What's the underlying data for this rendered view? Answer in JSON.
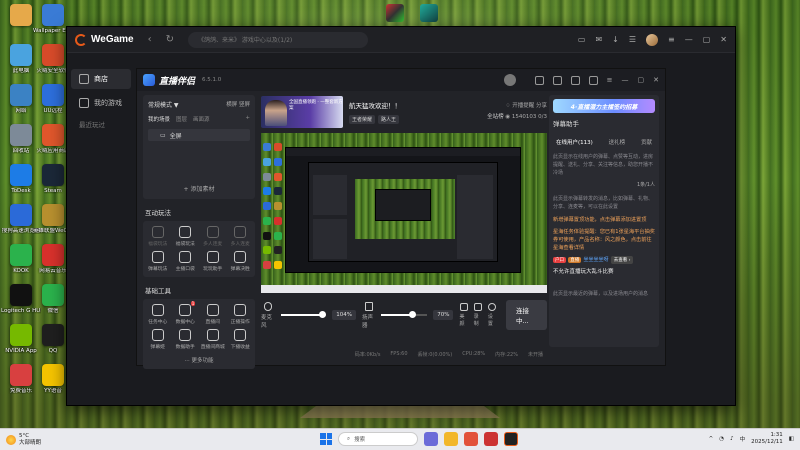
{
  "desktop": {
    "icons": [
      {
        "label": "",
        "color": "#e6a94a"
      },
      {
        "label": "Wallpaper Engine：...",
        "color": "#3a7bd5"
      },
      {
        "label": "此电脑",
        "color": "#4aa3df"
      },
      {
        "label": "火绒安全软件",
        "color": "#d84b2a"
      },
      {
        "label": "网络",
        "color": "#3b82c4"
      },
      {
        "label": "UU远程",
        "color": "#2d6fdc"
      },
      {
        "label": "回收站",
        "color": "#7d8a98"
      },
      {
        "label": "火绒应用商店",
        "color": "#e0572c"
      },
      {
        "label": "ToDesk",
        "color": "#1d7ce6"
      },
      {
        "label": "Steam",
        "color": "#1b2838"
      },
      {
        "label": "搜狗高速浏览器",
        "color": "#2b6ad8"
      },
      {
        "label": "英雄联盟WeGame版",
        "color": "#b8902f"
      },
      {
        "label": "KOOK",
        "color": "#2bb24c"
      },
      {
        "label": "网易云音乐",
        "color": "#d8312c"
      },
      {
        "label": "Logitech G HUB",
        "color": "#111111"
      },
      {
        "label": "微信",
        "color": "#2bb24c"
      },
      {
        "label": "NVIDIA App",
        "color": "#76b900"
      },
      {
        "label": "QQ",
        "color": "#1f1f1f"
      },
      {
        "label": "免费音乐",
        "color": "#d84040"
      },
      {
        "label": "YY语音",
        "color": "#f5c400"
      }
    ]
  },
  "wegame": {
    "title": "WeGame",
    "search_placeholder": "《鸽鸽、来米》 游戏中心以及(1/2)",
    "sidebar": [
      {
        "label": "商店",
        "active": true
      },
      {
        "label": "我的游戏",
        "active": false
      }
    ],
    "sidebar_sub": "最近玩过"
  },
  "app": {
    "title": "直播伴侣",
    "version": "6.5.1.0",
    "scene_mode": "常规模式 ▼",
    "scene_mode_right": [
      "横屏",
      "竖屏"
    ],
    "scene_tabs": [
      "我的场景",
      "图层",
      "画面源"
    ],
    "scene_add": "+",
    "scene_item": "全屏",
    "add_source": "+ 添加素材",
    "interact_title": "互动玩法",
    "interact_tools": [
      {
        "label": "福袋玩法",
        "dim": true
      },
      {
        "label": "福袋玩法",
        "dim": false
      },
      {
        "label": "多人连麦",
        "dim": true
      },
      {
        "label": "多人连麦",
        "dim": true
      },
      {
        "label": "弹幕玩法",
        "dim": false
      },
      {
        "label": "主播口袋",
        "dim": false
      },
      {
        "label": "玩玩助手",
        "dim": false
      },
      {
        "label": "弹幕决胜",
        "dim": false
      }
    ],
    "basic_title": "基础工具",
    "basic_tools": [
      {
        "label": "任务中心",
        "badge": ""
      },
      {
        "label": "数据中心",
        "badge": "1"
      },
      {
        "label": "直播间",
        "badge": ""
      },
      {
        "label": "正播操作",
        "badge": ""
      },
      {
        "label": "弹幕姬",
        "badge": ""
      },
      {
        "label": "数据助手",
        "badge": ""
      },
      {
        "label": "直播间商城",
        "badge": ""
      },
      {
        "label": "下播收益",
        "badge": ""
      }
    ],
    "more": "··· 更多功能",
    "streamer": {
      "banner_text": "全国直播领跑 · 一整套新方案",
      "name": "航天猛攻欢迎！！",
      "tags": [
        "王者荣耀",
        "路人王"
      ],
      "stats": [
        "开播提醒",
        "分享"
      ],
      "fans_link": "全站榜",
      "count": "1540103",
      "extra": "0/3"
    },
    "controls": {
      "mic_label": "麦克风",
      "mic_pct": "104%",
      "speaker_label": "扬声器",
      "speaker_pct": "70%",
      "mic_level": 0.75,
      "speaker_level": 0.55,
      "buttons": [
        "美颜",
        "录制",
        "设置"
      ],
      "start": "连接中..."
    },
    "status": [
      "码率:0Kb/s",
      "FPS:60",
      "丢帧:0(0.00%)",
      "CPU:28%",
      "内存:22%",
      "未开播"
    ],
    "right": {
      "promo": "4·直播潜力主播签约招募",
      "title": "弹幕助手",
      "tabs": [
        "在线用户(113)",
        "送礼榜",
        "贡献"
      ],
      "desc1": "此页显示在线用户的弹幕、点赞等互动，进房提醒、送礼、分享、关注等信息，助您开播不冷场",
      "counter": "1条/1人",
      "desc2": "此页显示弹幕转发的消息，比如弹幕、礼物、分享、连麦等，可以在此设置",
      "orange1": "新增弹幕置顶功能，点击弹幕添加进置顶",
      "orange2": "星海任务体验提醒：您已有1张星海平台抽奖券可使用，产品名称：风之颜色，点击前往星海查看详情",
      "chip_user": "户口",
      "chip_level": "直播",
      "blue_name": "坐坐坐坐呀",
      "go": "去查看 ›",
      "white_line": "不允许直播玩大乱斗比赛",
      "desc3": "此页显示最近的弹幕，以及进场用户的消息"
    }
  },
  "taskbar": {
    "weather_temp": "5°C",
    "weather_desc": "大部晴朗",
    "search": "搜索",
    "time": "1:31",
    "date": "2025/12/11"
  },
  "colors": {
    "accent": "#e85a19",
    "panel": "#2a2b31",
    "bg": "#1a1b1f"
  }
}
